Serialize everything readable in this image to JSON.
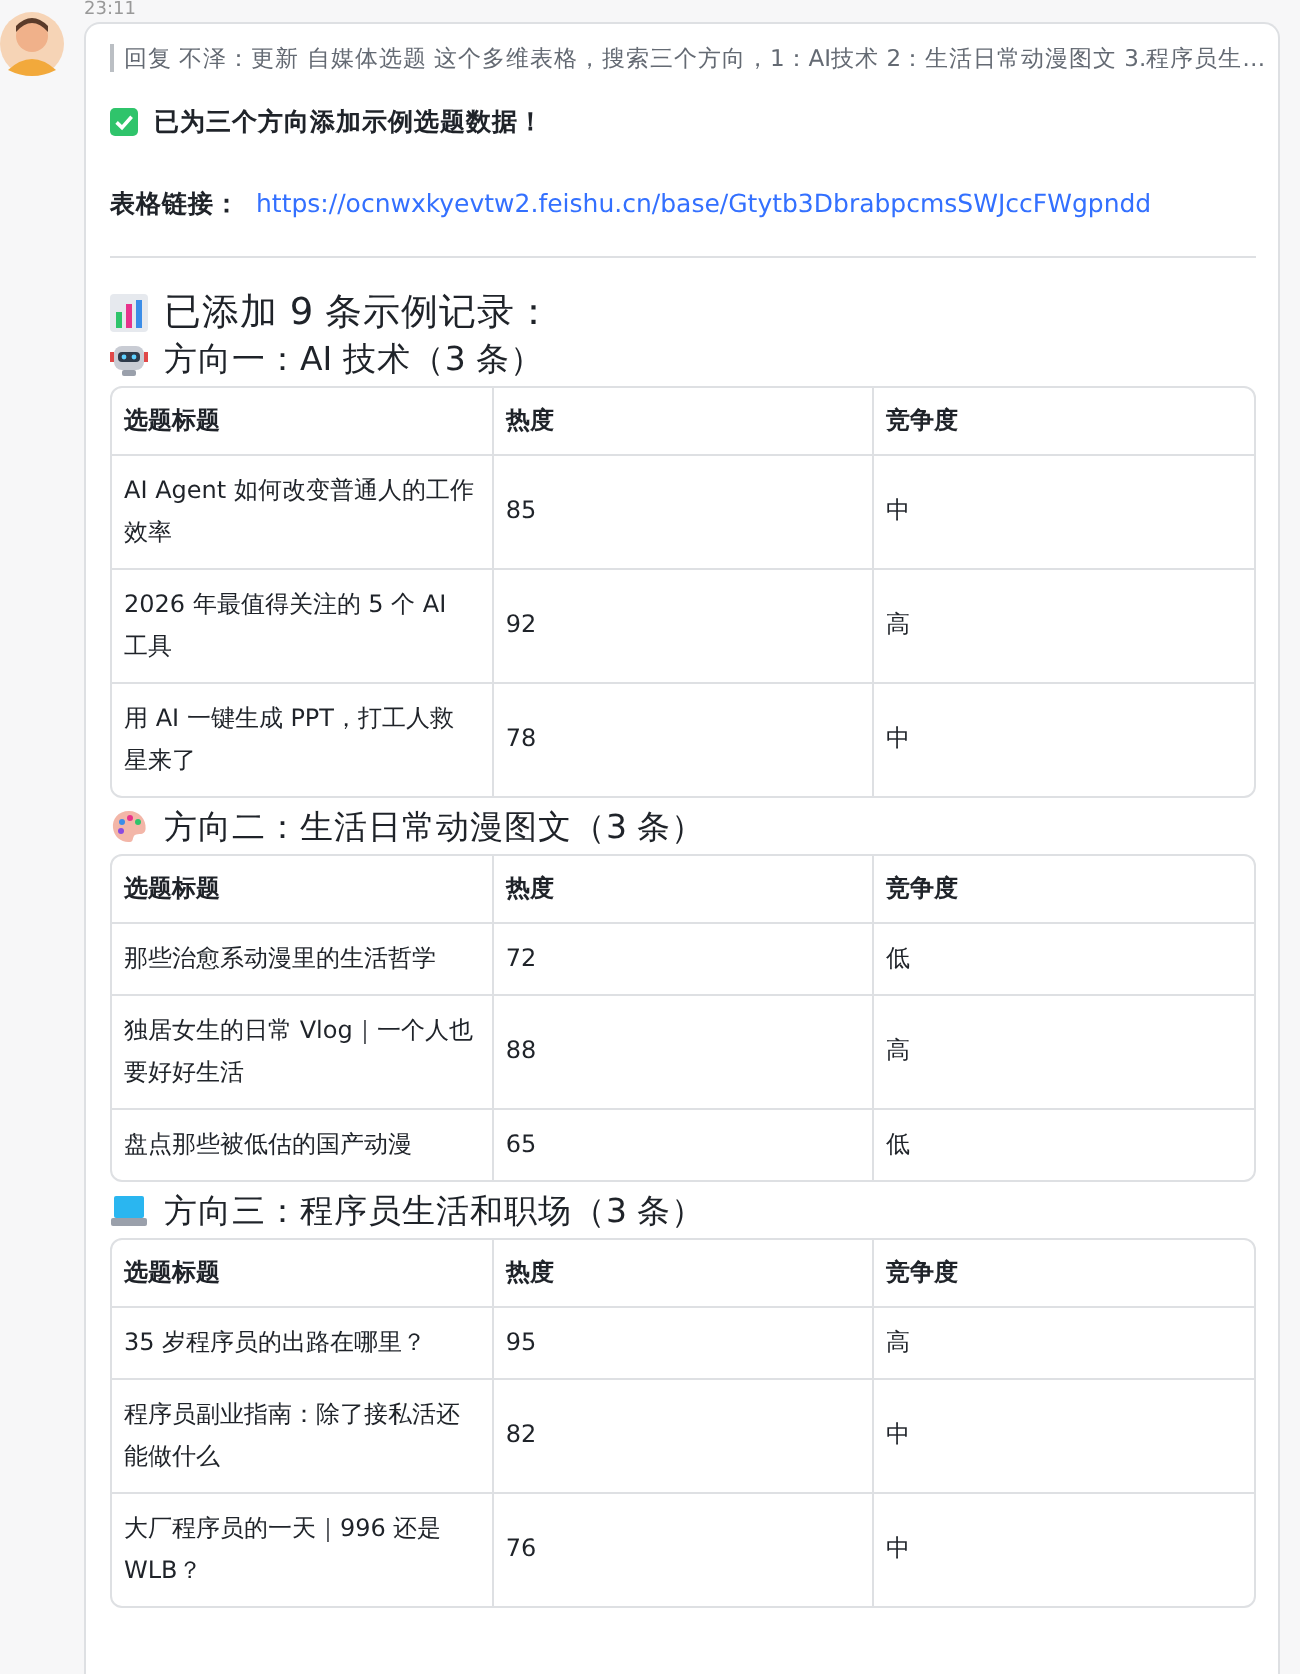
{
  "timestamp": "23:11",
  "message": {
    "reply_quote": "回复 不泽：更新 自媒体选题 这个多维表格，搜索三个方向，1：AI技术 2：生活日常动漫图文 3.程序员生…",
    "status": "已为三个方向添加示例选题数据！",
    "link_label": "表格链接：",
    "link": "https://ocnwxkyevtw2.feishu.cn/base/Gtytb3DbrabpcmsSWJccFWgpndd",
    "summary": "已添加 9 条示例记录：",
    "sections": [
      {
        "title": "方向一：AI 技术（3 条）",
        "columns": [
          "选题标题",
          "热度",
          "竞争度"
        ],
        "rows": [
          [
            "AI Agent 如何改变普通人的工作效率",
            "85",
            "中"
          ],
          [
            "2026 年最值得关注的 5 个 AI 工具",
            "92",
            "高"
          ],
          [
            "用 AI 一键生成 PPT，打工人救星来了",
            "78",
            "中"
          ]
        ]
      },
      {
        "title": "方向二：生活日常动漫图文（3 条）",
        "columns": [
          "选题标题",
          "热度",
          "竞争度"
        ],
        "rows": [
          [
            "那些治愈系动漫里的生活哲学",
            "72",
            "低"
          ],
          [
            "独居女生的日常 Vlog｜一个人也要好好生活",
            "88",
            "高"
          ],
          [
            "盘点那些被低估的国产动漫",
            "65",
            "低"
          ]
        ]
      },
      {
        "title": "方向三：程序员生活和职场（3 条）",
        "columns": [
          "选题标题",
          "热度",
          "竞争度"
        ],
        "rows": [
          [
            "35 岁程序员的出路在哪里？",
            "95",
            "高"
          ],
          [
            "程序员副业指南：除了接私活还能做什么",
            "82",
            "中"
          ],
          [
            "大厂程序员的一天｜996 还是 WLB？",
            "76",
            "中"
          ]
        ]
      }
    ]
  }
}
